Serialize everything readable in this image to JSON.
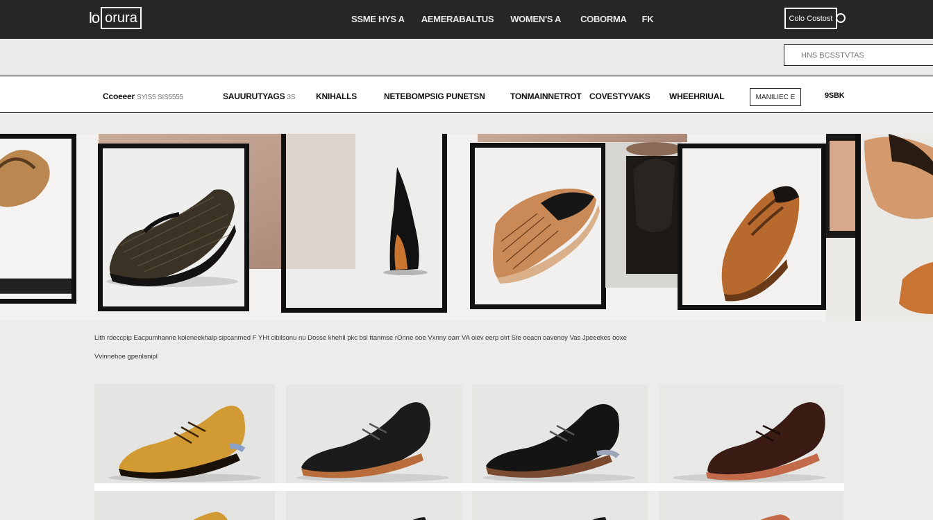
{
  "header": {
    "logo_prefix": "lo",
    "logo_boxed": "orura",
    "nav": [
      "SSME HYS A",
      "AEMERABALTUS",
      "WOMEN'S A",
      "COBORMA",
      "FK"
    ],
    "account_label": "Colo Costost"
  },
  "search": {
    "placeholder": "HNS BCSSTVTAS"
  },
  "categories": {
    "items": [
      {
        "label": "Ccoeeer",
        "dim": "SYIS5  SIS5555"
      },
      {
        "label": "SAUURUTYAGS",
        "dim": "3S"
      },
      {
        "label": "KNIHALLS",
        "dim": ""
      },
      {
        "label": "NETEBOMPSIG PUNETSN",
        "dim": ""
      },
      {
        "label": "TONMAINNETROT",
        "dim": ""
      },
      {
        "label": "COVESTYVAKS",
        "dim": ""
      },
      {
        "label": "WHEEHRIUAL",
        "dim": ""
      }
    ],
    "boxed_label": "MANILIEC E",
    "last_label": "9SBK"
  },
  "description": {
    "text": "Lith rdeccpip Eacpumhanne koleneekhalp sipcanmed F YHt cibilsonu nu Dosse  khehil pkc bsl ttanmse rOnne ooe Vxnny oarr VA oiev eerp oirt Ste oeacn oavenoy Vas Jpeeekes ooxe",
    "sub": "Vvinnehoe gpenlanipl"
  },
  "colors": {
    "topbar": "#262626",
    "accent_tan": "#c9742f",
    "accent_mustard": "#d29a33"
  },
  "icons": {
    "search": "search-icon"
  }
}
